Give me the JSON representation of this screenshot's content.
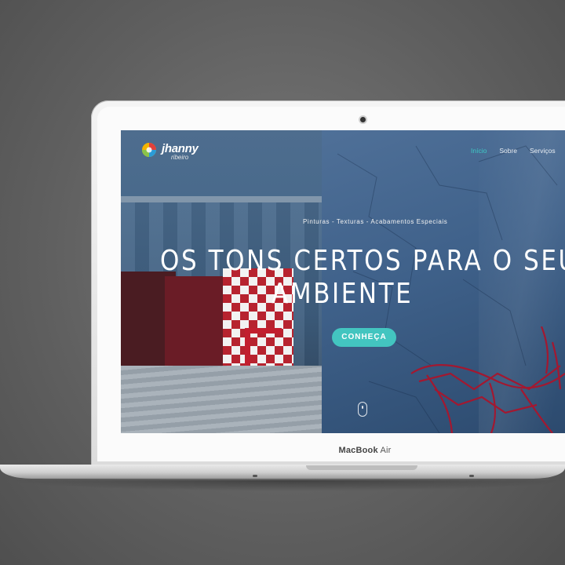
{
  "device": {
    "model_brand": "MacBook",
    "model_name": "Air"
  },
  "site": {
    "logo": {
      "name": "jhanny",
      "subtitle": "ribeiro"
    },
    "nav": {
      "items": [
        {
          "label": "Início",
          "active": true
        },
        {
          "label": "Sobre",
          "active": false
        },
        {
          "label": "Serviços",
          "active": false
        }
      ]
    },
    "hero": {
      "tagline": "Pinturas - Texturas - Acabamentos Especiais",
      "headline_line1": "OS TONS CERTOS PARA O SEU",
      "headline_line2": "AMBIENTE",
      "cta_label": "CONHEÇA"
    }
  },
  "colors": {
    "accent": "#43c5c0",
    "nav_active": "#3ec9c6",
    "hero_text": "#ffffff",
    "chair_red": "#a31830"
  },
  "icons": {
    "logo_mark": "colorful-swirl-icon",
    "scroll": "mouse-scroll-icon"
  }
}
